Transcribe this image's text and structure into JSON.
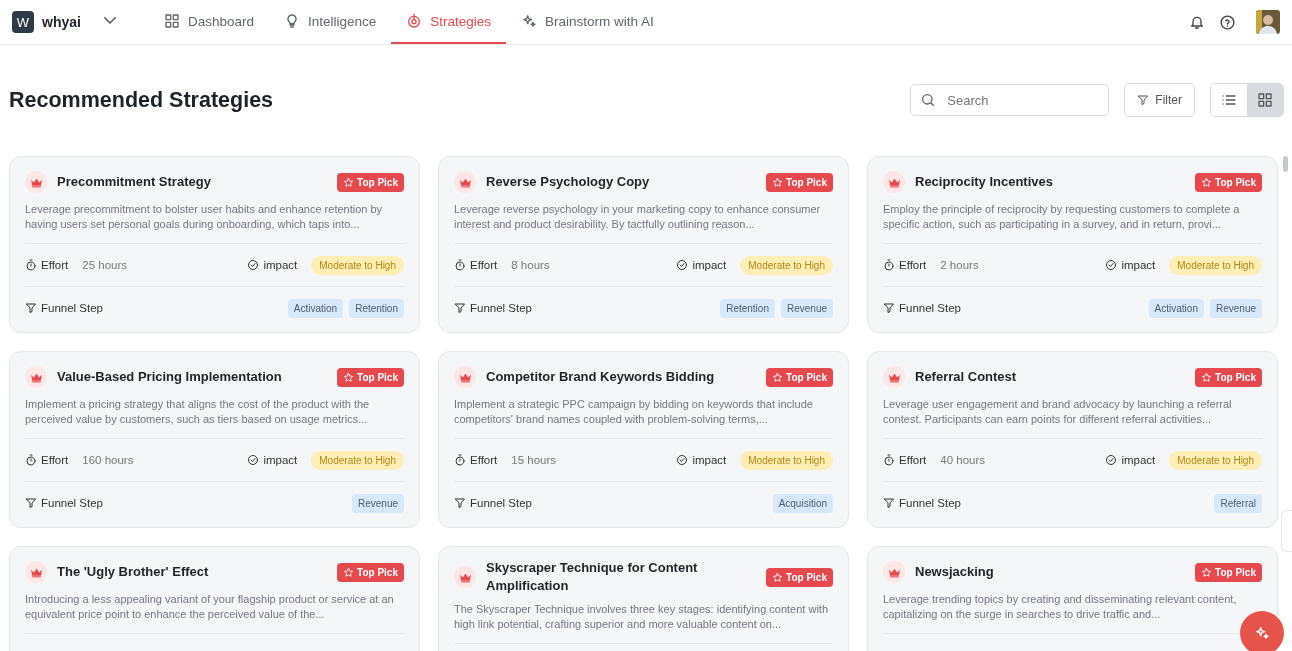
{
  "nav": {
    "workspace_initial": "W",
    "workspace": "whyai",
    "tabs": [
      {
        "label": "Dashboard",
        "kind": "grid",
        "selected": false
      },
      {
        "label": "Intelligence",
        "kind": "bulb",
        "selected": false
      },
      {
        "label": "Strategies",
        "kind": "target",
        "selected": true
      },
      {
        "label": "Brainstorm with AI",
        "kind": "sparkle",
        "selected": false
      }
    ]
  },
  "page_title": "Recommended Strategies",
  "search": {
    "placeholder": "Search"
  },
  "filter_label": "Filter",
  "views": [
    {
      "kind": "list",
      "selected": false
    },
    {
      "kind": "grid",
      "selected": true
    }
  ],
  "cards": [
    {
      "title": "Precommitment Strategy",
      "badge": "Top Pick",
      "description": "Leverage precommitment to bolster user habits and enhance retention by having users set personal goals during onboarding, which taps into...",
      "effort_label": "Effort",
      "effort": "25 hours",
      "impact_label": "impact",
      "impact": "Moderate to High",
      "funnel_label": "Funnel Step",
      "funnel_steps": [
        "Activation",
        "Retention"
      ]
    },
    {
      "title": "Reverse Psychology Copy",
      "badge": "Top Pick",
      "description": "Leverage reverse psychology in your marketing copy to enhance consumer interest and product desirability. By tactfully outlining reason...",
      "effort_label": "Effort",
      "effort": "8 hours",
      "impact_label": "impact",
      "impact": "Moderate to High",
      "funnel_label": "Funnel Step",
      "funnel_steps": [
        "Retention",
        "Revenue"
      ]
    },
    {
      "title": "Reciprocity Incentives",
      "badge": "Top Pick",
      "description": "Employ the principle of reciprocity by requesting customers to complete a specific action, such as participating in a survey, and in return, provi...",
      "effort_label": "Effort",
      "effort": "2 hours",
      "impact_label": "impact",
      "impact": "Moderate to High",
      "funnel_label": "Funnel Step",
      "funnel_steps": [
        "Activation",
        "Revenue"
      ]
    },
    {
      "title": "Value-Based Pricing Implementation",
      "badge": "Top Pick",
      "description": "Implement a pricing strategy that aligns the cost of the product with the perceived value by customers, such as tiers based on usage metrics...",
      "effort_label": "Effort",
      "effort": "160 hours",
      "impact_label": "impact",
      "impact": "Moderate to High",
      "funnel_label": "Funnel Step",
      "funnel_steps": [
        "Revenue"
      ]
    },
    {
      "title": "Competitor Brand Keywords Bidding",
      "badge": "Top Pick",
      "description": "Implement a strategic PPC campaign by bidding on keywords that include competitors' brand names coupled with problem-solving terms,...",
      "effort_label": "Effort",
      "effort": "15 hours",
      "impact_label": "impact",
      "impact": "Moderate to High",
      "funnel_label": "Funnel Step",
      "funnel_steps": [
        "Acquisition"
      ]
    },
    {
      "title": "Referral Contest",
      "badge": "Top Pick",
      "description": "Leverage user engagement and brand advocacy by launching a referral contest. Participants can earn points for different referral activities...",
      "effort_label": "Effort",
      "effort": "40 hours",
      "impact_label": "impact",
      "impact": "Moderate to High",
      "funnel_label": "Funnel Step",
      "funnel_steps": [
        "Referral"
      ]
    },
    {
      "title": "The 'Ugly Brother' Effect",
      "badge": "Top Pick",
      "description": "Introducing a less appealing variant of your flagship product or service at an equivalent price point to enhance the perceived value of the..."
    },
    {
      "title": "Skyscraper Technique for Content Amplification",
      "badge": "Top Pick",
      "description": "The Skyscraper Technique involves three key stages: identifying content with high link potential, crafting superior and more valuable content on..."
    },
    {
      "title": "Newsjacking",
      "badge": "Top Pick",
      "description": "Leverage trending topics by creating and disseminating relevant content, capitalizing on the surge in searches to drive traffic and..."
    }
  ]
}
